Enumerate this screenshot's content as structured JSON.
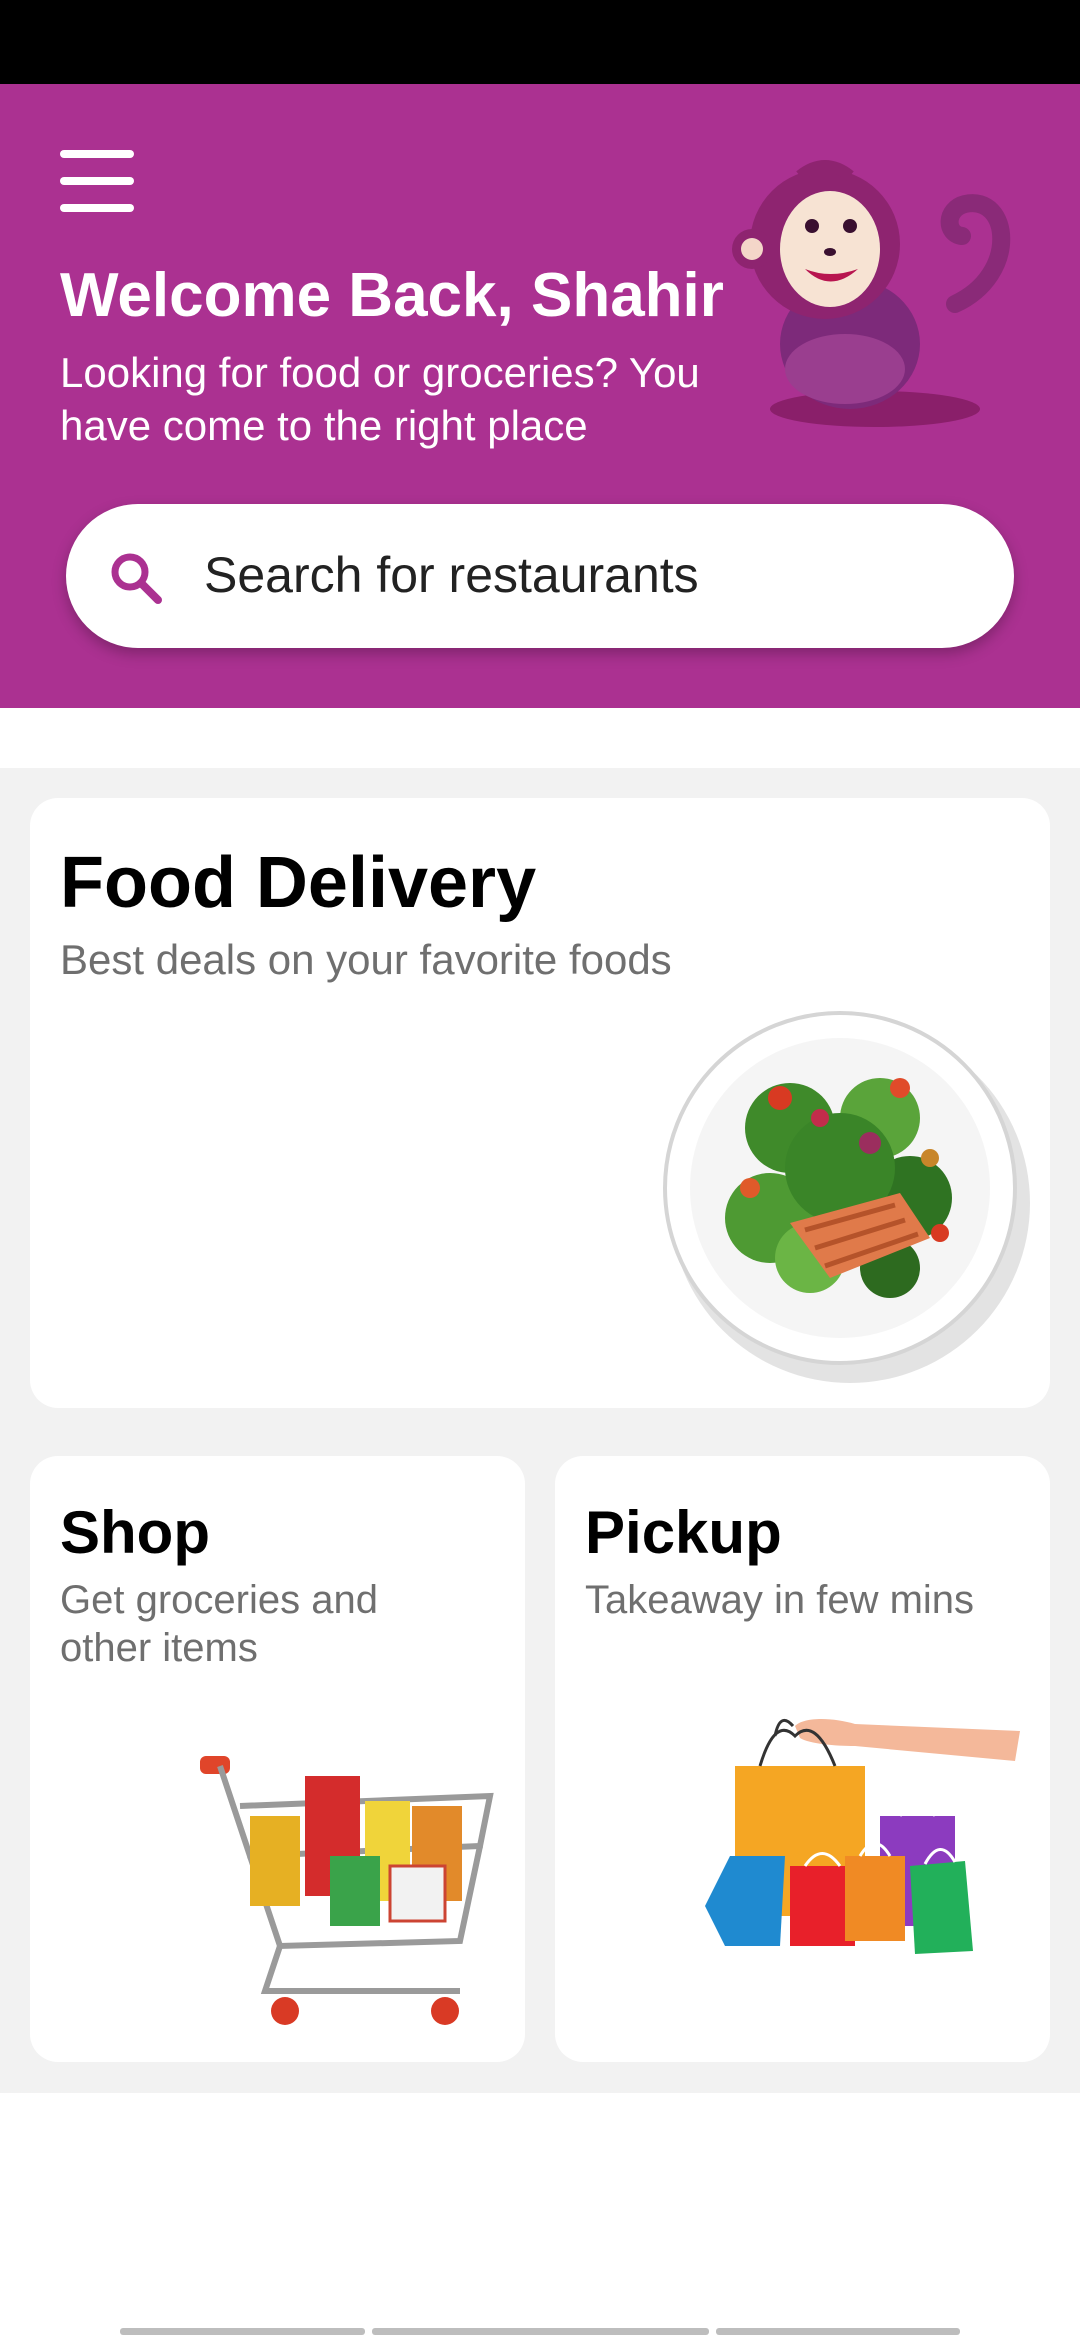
{
  "header": {
    "welcome": "Welcome Back, Shahir",
    "subtitle": "Looking for food or groceries? You have come to the right place",
    "mascot": "monkey-mascot",
    "background_color": "#ab3191"
  },
  "search": {
    "placeholder": "Search for restaurants",
    "icon": "search-icon"
  },
  "cards": {
    "food_delivery": {
      "title": "Food Delivery",
      "subtitle": "Best deals on your favorite foods",
      "image": "salmon-salad-plate"
    },
    "shop": {
      "title": "Shop",
      "subtitle": "Get groceries and other items",
      "image": "grocery-cart"
    },
    "pickup": {
      "title": "Pickup",
      "subtitle": "Takeaway in few mins",
      "image": "shopping-bags"
    }
  }
}
